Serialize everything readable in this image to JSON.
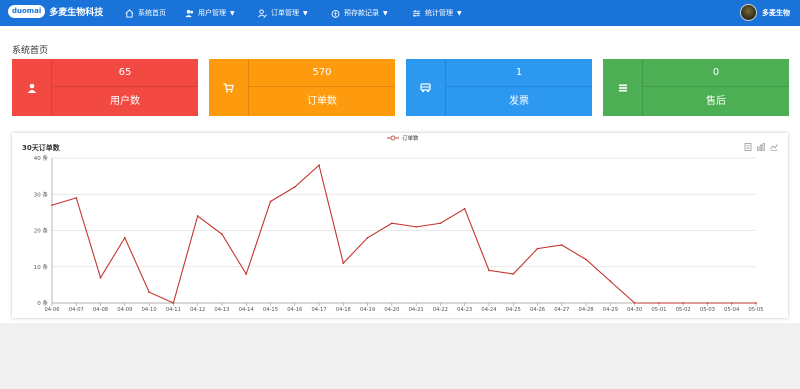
{
  "header": {
    "logo_badge": "duomai",
    "logo_text": "多麦生物科技",
    "nav": [
      {
        "label": "系统首页",
        "icon": "home-icon",
        "has_caret": false
      },
      {
        "label": "用户管理",
        "icon": "users-icon",
        "has_caret": true
      },
      {
        "label": "订单管理",
        "icon": "user-edit-icon",
        "has_caret": true
      },
      {
        "label": "预存款记录",
        "icon": "money-bag-icon",
        "has_caret": true
      },
      {
        "label": "统计管理",
        "icon": "sliders-icon",
        "has_caret": true
      }
    ],
    "user_name": "多麦生物"
  },
  "page_title": "系统首页",
  "cards": [
    {
      "value": "65",
      "label": "用户数",
      "icon": "user-icon",
      "color": "#f24a43"
    },
    {
      "value": "570",
      "label": "订单数",
      "icon": "cart-icon",
      "color": "#fd9a0d"
    },
    {
      "value": "1",
      "label": "发票",
      "icon": "invoice-icon",
      "color": "#2c98f0"
    },
    {
      "value": "0",
      "label": "售后",
      "icon": "list-icon",
      "color": "#4daf53"
    }
  ],
  "chart_data": {
    "type": "line",
    "title": "30天订单数",
    "legend": "订单数",
    "legend_position": "top-center",
    "x": [
      "04-06",
      "04-07",
      "04-08",
      "04-09",
      "04-10",
      "04-11",
      "04-12",
      "04-13",
      "04-14",
      "04-15",
      "04-16",
      "04-17",
      "04-18",
      "04-19",
      "04-20",
      "04-21",
      "04-22",
      "04-23",
      "04-24",
      "04-25",
      "04-26",
      "04-27",
      "04-28",
      "04-29",
      "04-30",
      "05-01",
      "05-02",
      "05-03",
      "05-04",
      "05-05"
    ],
    "series": [
      {
        "name": "订单数",
        "values": [
          27,
          29,
          7,
          18,
          3,
          0,
          24,
          19,
          8,
          28,
          32,
          38,
          11,
          18,
          22,
          21,
          22,
          26,
          9,
          8,
          15,
          16,
          12,
          6,
          0,
          0,
          0,
          0,
          0,
          0
        ]
      }
    ],
    "ylim": [
      0,
      40
    ],
    "yticks": [
      0,
      10,
      20,
      30,
      40
    ],
    "ytick_suffix": " 条",
    "grid": true,
    "line_color": "#c23531"
  }
}
